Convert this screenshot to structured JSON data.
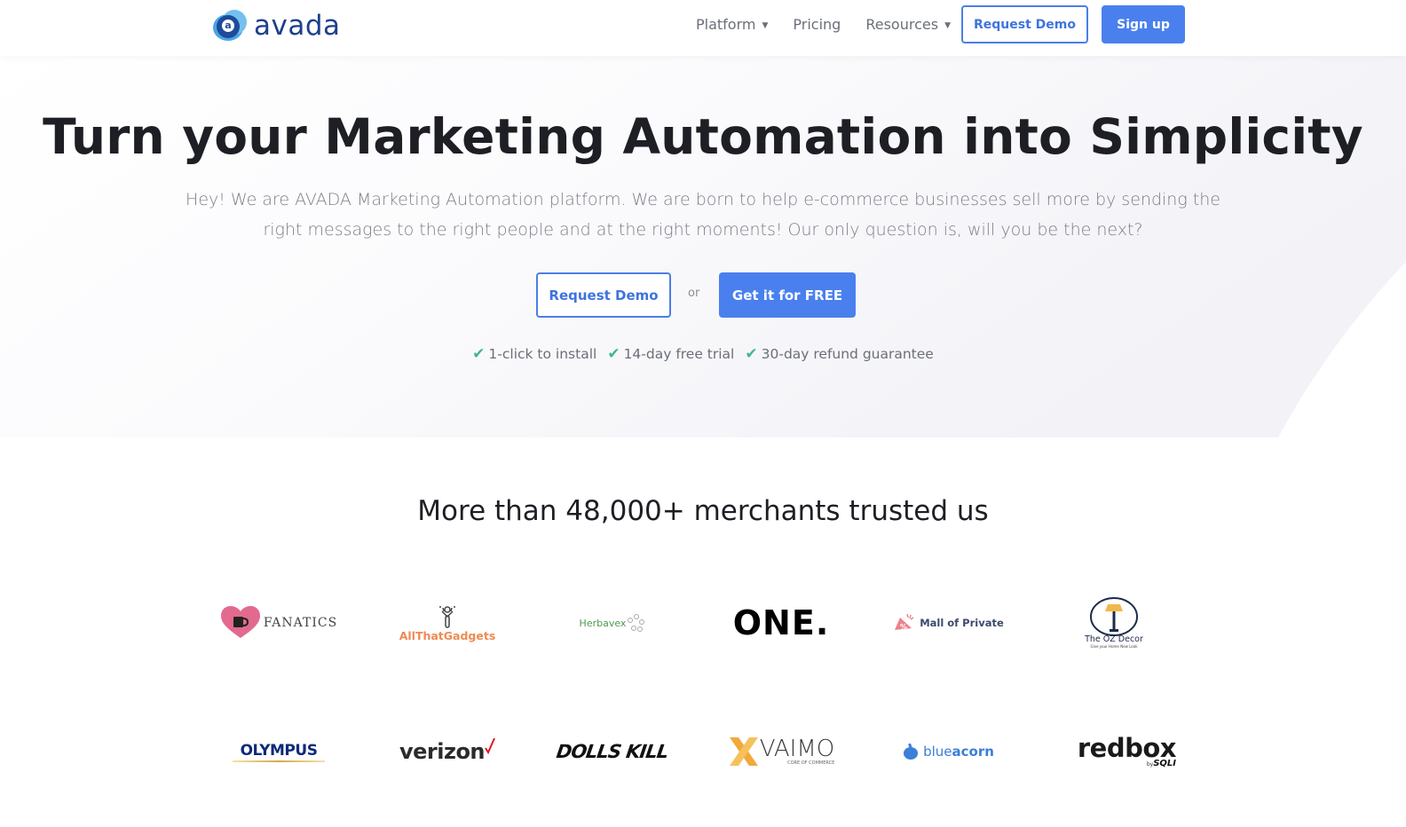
{
  "header": {
    "brand": "avada",
    "brand_mark_letter": "a",
    "nav": [
      {
        "label": "Platform",
        "has_dropdown": true
      },
      {
        "label": "Pricing",
        "has_dropdown": false
      },
      {
        "label": "Resources",
        "has_dropdown": true
      }
    ],
    "request_demo_label": "Request Demo",
    "sign_up_label": "Sign up"
  },
  "hero": {
    "title": "Turn your Marketing Automation into Simplicity",
    "subtitle": "Hey! We are AVADA Marketing Automation platform. We are born to help e-commerce businesses sell more by sending the right messages to the right people and at the right moments! Our only question is, will you be the next?",
    "request_demo_label": "Request Demo",
    "or_label": "or",
    "get_free_label": "Get it for FREE",
    "features": [
      {
        "icon": "check-icon",
        "label": "1-click to install"
      },
      {
        "icon": "check-icon",
        "label": "14-day free trial"
      },
      {
        "icon": "check-icon",
        "label": "30-day refund guarantee"
      }
    ]
  },
  "trusted": {
    "heading": "More than 48,000+ merchants trusted us",
    "logos_row1": [
      {
        "name": "FANATICS"
      },
      {
        "name": "AllThatGadgets"
      },
      {
        "name": "Herbavex"
      },
      {
        "name": "ONE."
      },
      {
        "name": "Mall of Private"
      },
      {
        "name": "The OZ Decor",
        "tagline": "Give your Home New Look"
      }
    ],
    "logos_row2": [
      {
        "name": "OLYMPUS"
      },
      {
        "name": "verizon"
      },
      {
        "name": "DOLLS KILL"
      },
      {
        "name": "VAIMO",
        "tagline": "CORE OF COMMERCE"
      },
      {
        "name_light": "blue",
        "name_bold": "acorn"
      },
      {
        "name": "redbox",
        "tagline_prefix": "by",
        "tagline": "SQLI"
      }
    ]
  },
  "colors": {
    "accent": "#4a80ee",
    "brand_dark": "#1e3f8c",
    "check": "#3fb98a",
    "text_dark": "#1d1f24",
    "text_muted": "#7b7f88"
  }
}
